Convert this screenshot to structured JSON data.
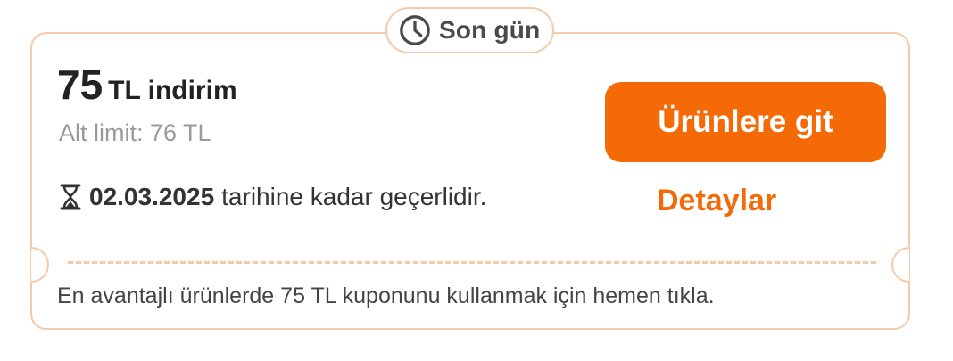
{
  "badge": {
    "icon": "clock-icon",
    "label": "Son gün"
  },
  "coupon": {
    "amount": "75",
    "amount_suffix": "TL indirim",
    "min_limit": "Alt limit: 76 TL",
    "valid_icon": "hourglass-icon",
    "valid_date": "02.03.2025",
    "valid_suffix": "tarihine kadar geçerlidir."
  },
  "actions": {
    "primary_label": "Ürünlere git",
    "details_label": "Detaylar"
  },
  "footer_text": "En avantajlı ürünlerde 75 TL kuponunu kullanmak için hemen tıkla.",
  "colors": {
    "accent": "#f36a07",
    "border": "#f6c9a8",
    "text": "#222222",
    "muted": "#9a9a9a"
  }
}
